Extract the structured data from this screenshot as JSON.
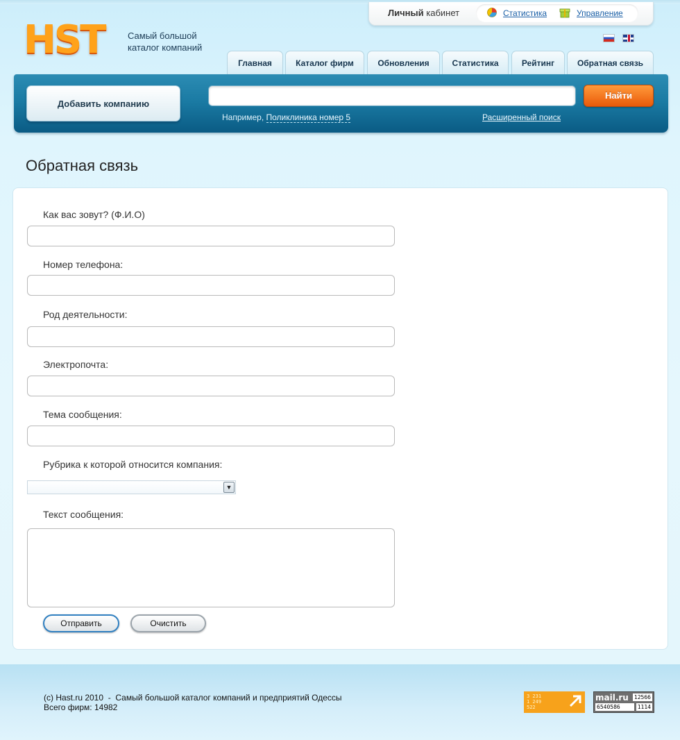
{
  "account": {
    "title_bold": "Личный",
    "title_rest": "кабинет",
    "links": [
      {
        "label": "Статистика",
        "icon": "chart-pie-icon"
      },
      {
        "label": "Управление",
        "icon": "gift-box-icon"
      }
    ]
  },
  "logo": {
    "text": "HST"
  },
  "tagline": {
    "line1": "Самый большой",
    "line2": "каталог компаний"
  },
  "languages": [
    {
      "code": "ru",
      "icon": "flag-ru-icon"
    },
    {
      "code": "en",
      "icon": "flag-en-icon"
    }
  ],
  "tabs": [
    "Главная",
    "Каталог фирм",
    "Обновления",
    "Статистика",
    "Рейтинг",
    "Обратная связь"
  ],
  "search": {
    "add_company_label": "Добавить компанию",
    "input_value": "",
    "button_label": "Найти",
    "example_prefix": "Например,",
    "example_link": "Поликлиника номер 5",
    "advanced_label": "Расширенный поиск"
  },
  "page": {
    "title": "Обратная связь"
  },
  "form": {
    "name_label": "Как вас зовут? (Ф.И.О)",
    "phone_label": "Номер телефона:",
    "activity_label": "Род деятельности:",
    "email_label": "Электропочта:",
    "subject_label": "Тема сообщения:",
    "rubric_label": "Рубрика к которой относится компания:",
    "rubric_value": "",
    "message_label": "Текст сообщения:",
    "submit_label": "Отправить",
    "clear_label": "Очистить"
  },
  "footer": {
    "copyright": "(c) Hast.ru 2010  -  Самый большой каталог компаний и предприятий Одессы",
    "total": "Всего фирм: 14982",
    "counter1": {
      "line1": "3 231",
      "line2": "1 249",
      "line3": "522"
    },
    "counter2": {
      "brand": "mail.ru",
      "v1": "12566",
      "v2": "6540586",
      "v3": "1114"
    }
  },
  "colors": {
    "accent_orange": "#ea5a0a",
    "band_blue": "#1a7aa3",
    "link_blue": "#1a5fa6"
  }
}
